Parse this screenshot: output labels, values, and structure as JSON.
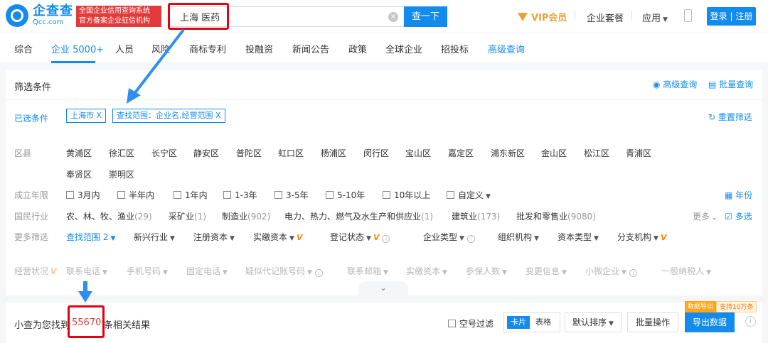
{
  "header": {
    "logo_main": "企查查",
    "logo_sub": "Qcc.com",
    "cert_line1": "全国企业信用查询系统",
    "cert_line2": "官方备案企业征信机构",
    "search_value": "上海 医药",
    "search_button": "查一下",
    "vip": "VIP会员",
    "package": "企业套餐",
    "apps": "应用",
    "login": "登录 | 注册"
  },
  "tabs": [
    {
      "label": "综合"
    },
    {
      "label": "企业 5000+"
    },
    {
      "label": "人员"
    },
    {
      "label": "风险"
    },
    {
      "label": "商标专利"
    },
    {
      "label": "投融资"
    },
    {
      "label": "新闻公告"
    },
    {
      "label": "政策"
    },
    {
      "label": "全球企业"
    },
    {
      "label": "招投标"
    },
    {
      "label": "高级查询"
    }
  ],
  "filters": {
    "title": "筛选条件",
    "advanced_search": "高级查询",
    "batch_search": "批量查询",
    "selected_label": "已选条件",
    "selected_tags": [
      "上海市 X",
      "查找范围：企业名,经营范围 X"
    ],
    "reset": "重置筛选",
    "district_label": "区县",
    "districts_row1": [
      "黄浦区",
      "徐汇区",
      "长宁区",
      "静安区",
      "普陀区",
      "虹口区",
      "杨浦区",
      "闵行区",
      "宝山区",
      "嘉定区",
      "浦东新区",
      "金山区",
      "松江区",
      "青浦区"
    ],
    "districts_row2": [
      "奉贤区",
      "崇明区"
    ],
    "founded_label": "成立年限",
    "founded": [
      "3月内",
      "半年内",
      "1年内",
      "1-3年",
      "3-5年",
      "5-10年",
      "10年以上",
      "自定义"
    ],
    "year_toggle": "年份",
    "industry_label": "国民行业",
    "industries": [
      {
        "name": "农、林、牧、渔业",
        "count": "(29)"
      },
      {
        "name": "采矿业",
        "count": "(1)"
      },
      {
        "name": "制造业",
        "count": "(902)"
      },
      {
        "name": "电力、热力、燃气及水生产和供应业",
        "count": "(1)"
      },
      {
        "name": "建筑业",
        "count": "(173)"
      },
      {
        "name": "批发和零售业",
        "count": "(9080)"
      }
    ],
    "more": "更多",
    "multi": "多选",
    "more_filters_label": "更多筛选",
    "scope": "查找范围 2",
    "more_filters": [
      "新兴行业",
      "注册资本",
      "实缴资本",
      "登记状态",
      "企业类型",
      "组织机构",
      "资本类型",
      "分支机构"
    ],
    "faded": [
      "经营状况",
      "联系电话",
      "手机号码",
      "固定电话",
      "疑似代记账号码",
      "联系邮箱",
      "实缴资本",
      "参保人数",
      "变更信息",
      "小微企业",
      "一般纳税人"
    ]
  },
  "results": {
    "prefix": "小查为您找到",
    "count": "55670",
    "suffix": "条相关结果",
    "empty_filter": "空号过滤",
    "view_card": "卡片",
    "view_table": "表格",
    "sort": "默认排序",
    "batch": "批量操作",
    "export": "导出数据",
    "export_badge_a": "数据导出",
    "export_badge_b": "支持10万条"
  }
}
